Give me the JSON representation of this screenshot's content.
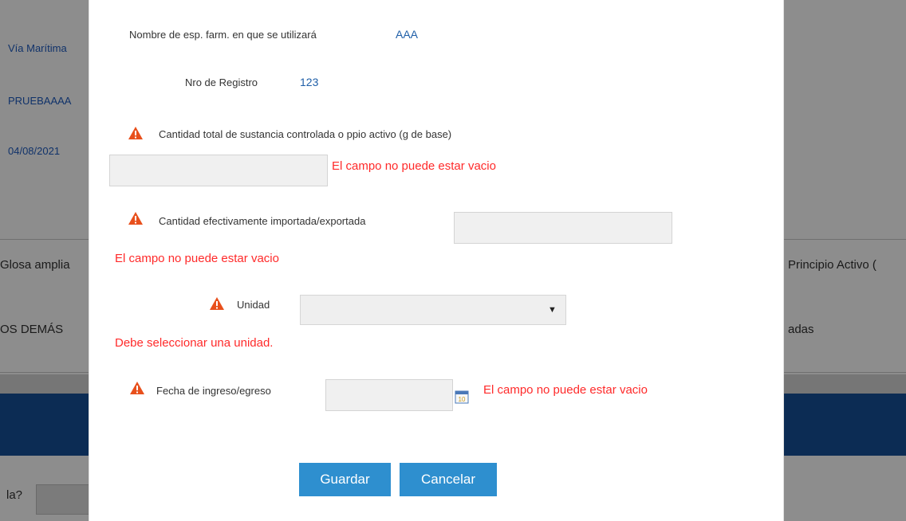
{
  "background": {
    "col1_values": [
      "Vía Marítima",
      "PRUEBAAAA",
      "04/08/2021"
    ],
    "row_label_left": "Glosa amplia",
    "row_label_right": "Principio Activo (",
    "row2_left": "OS DEMÁS",
    "row2_right": "adas",
    "question_label": "la?"
  },
  "form": {
    "nombre_label": "Nombre de esp. farm. en que se utilizará",
    "nombre_value": "AAA",
    "registro_label": "Nro de Registro",
    "registro_value": "123",
    "cantidad_total_label": "Cantidad total de sustancia controlada o ppio activo (g de base)",
    "cantidad_total_error": "El campo no puede estar vacio",
    "cantidad_efectiva_label": "Cantidad efectivamente importada/exportada",
    "cantidad_efectiva_error": "El campo no puede estar vacio",
    "unidad_label": "Unidad",
    "unidad_error": "Debe seleccionar una unidad.",
    "fecha_label": "Fecha de ingreso/egreso",
    "fecha_error": "El campo no puede estar vacio",
    "calendar_day": "10"
  },
  "buttons": {
    "guardar": "Guardar",
    "cancelar": "Cancelar"
  },
  "colors": {
    "error": "#ff2a2a",
    "primary_button": "#2e8fcf",
    "value_text": "#1f5fa8",
    "warning": "#e8501c"
  }
}
